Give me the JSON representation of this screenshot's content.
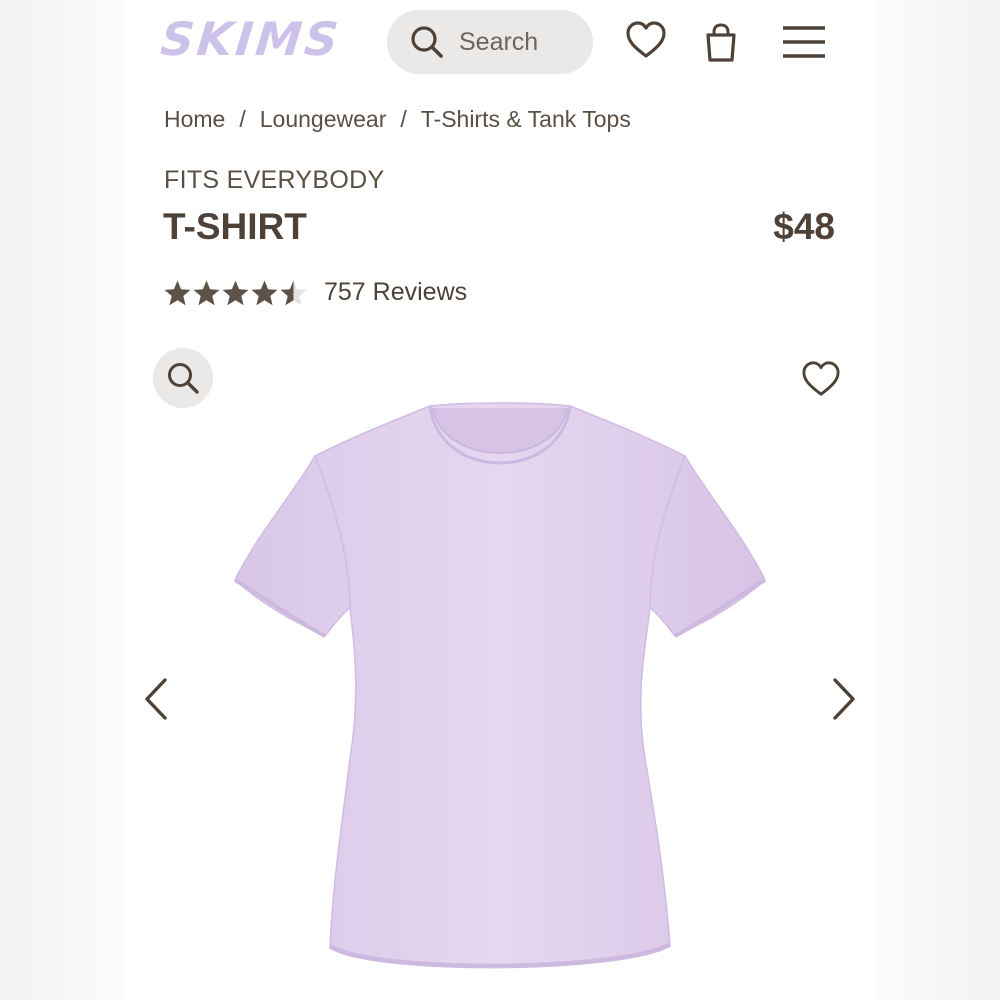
{
  "header": {
    "logo": "SKIMS",
    "search_placeholder": "Search",
    "icons": [
      "search-icon",
      "heart-icon",
      "shopping-bag-icon",
      "menu-icon"
    ]
  },
  "breadcrumb": [
    "Home",
    "Loungewear",
    "T-Shirts & Tank Tops"
  ],
  "breadcrumb_separator": "/",
  "product": {
    "collection": "FITS EVERYBODY",
    "name": "T-SHIRT",
    "price": "$48",
    "rating": 4.5,
    "rating_max": 5,
    "reviews_label": "757 Reviews",
    "image_color": "#e3d3ee"
  },
  "gallery": {
    "icons": [
      "zoom-icon",
      "wishlist-heart-icon",
      "chevron-left-icon",
      "chevron-right-icon"
    ]
  },
  "colors": {
    "text": "#5a4f45",
    "logo": "#cdc3ea",
    "pill": "#ebe9e8",
    "star": "#5e5248"
  }
}
